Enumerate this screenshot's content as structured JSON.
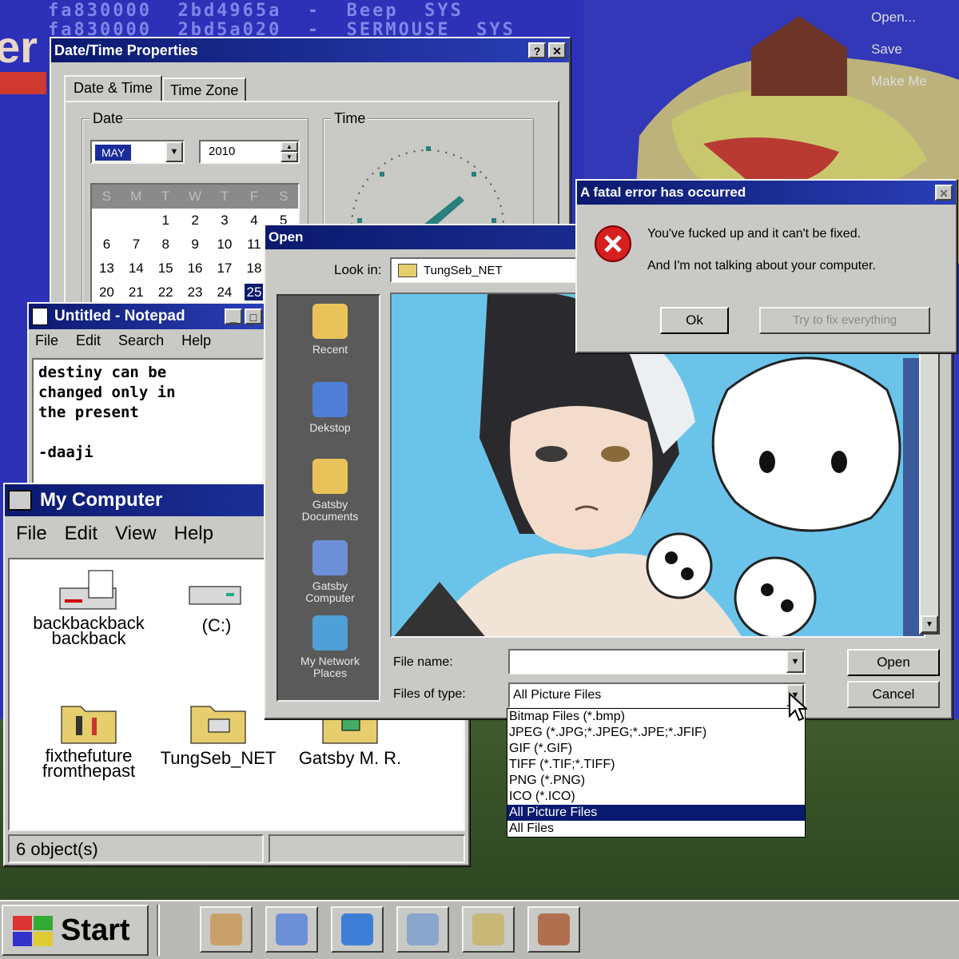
{
  "desktop": {
    "hex_rows": [
      "fa830000  2bd4965a  -  Beep  SYS",
      "fa830000  2bd5a020  -  SERMOUSE  SYS"
    ],
    "bg_fragment": "er",
    "context_menu": [
      "Open...",
      "Save",
      "Make Me"
    ]
  },
  "datetime_window": {
    "title": "Date/Time Properties",
    "help_btn": "?",
    "close_btn": "✕",
    "tabs": [
      "Date & Time",
      "Time Zone"
    ],
    "date_group": "Date",
    "time_group": "Time",
    "month": "MAY",
    "year": "2010",
    "weekdays": [
      "S",
      "M",
      "T",
      "W",
      "T",
      "F",
      "S"
    ],
    "weeks": [
      [
        "",
        "",
        "1",
        "2",
        "3",
        "4",
        "5"
      ],
      [
        "6",
        "7",
        "8",
        "9",
        "10",
        "11",
        ""
      ],
      [
        "13",
        "14",
        "15",
        "16",
        "17",
        "18",
        ""
      ],
      [
        "20",
        "21",
        "22",
        "23",
        "24",
        "25",
        ""
      ]
    ],
    "selected_day": "25"
  },
  "notepad": {
    "title": "Untitled - Notepad",
    "menu": [
      "File",
      "Edit",
      "Search",
      "Help"
    ],
    "text": "destiny can be\nchanged only in\nthe present\n\n-daaji"
  },
  "my_computer": {
    "title": "My Computer",
    "menu": [
      "File",
      "Edit",
      "View",
      "Help"
    ],
    "items": [
      {
        "label": "backbackback\nbackback",
        "icon": "floppy-drive-icon"
      },
      {
        "label": "(C:)",
        "icon": "hard-drive-icon"
      },
      {
        "label": "fixthefuture\nfromthepast",
        "icon": "control-panel-folder-icon"
      },
      {
        "label": "TungSeb_NET",
        "icon": "printers-folder-icon"
      },
      {
        "label": "Gatsby M. R.",
        "icon": "folder-icon"
      }
    ],
    "status": "6 object(s)"
  },
  "open_dialog": {
    "title": "Open",
    "look_in_label": "Look in:",
    "look_in_value": "TungSeb_NET",
    "places": [
      {
        "label": "Recent",
        "icon": "recent-folder-icon",
        "color": "#e9c35a"
      },
      {
        "label": "Dekstop",
        "icon": "desktop-icon",
        "color": "#4f7fd6"
      },
      {
        "label": "Gatsby\nDocuments",
        "icon": "documents-folder-icon",
        "color": "#e9c35a"
      },
      {
        "label": "Gatsby\nComputer",
        "icon": "computer-icon",
        "color": "#6d8fd8"
      },
      {
        "label": "My Network\nPlaces",
        "icon": "network-icon",
        "color": "#4fa0d6"
      }
    ],
    "file_name_label": "File name:",
    "file_name_value": "",
    "files_of_type_label": "Files of type:",
    "files_of_type_value": "All Picture Files",
    "open_btn": "Open",
    "cancel_btn": "Cancel",
    "type_options": [
      "Bitmap Files (*.bmp)",
      "JPEG (*.JPG;*.JPEG;*.JPE;*.JFIF)",
      "GIF (*.GIF)",
      "TIFF (*.TIF;*.TIFF)",
      "PNG (*.PNG)",
      "ICO (*.ICO)",
      "All Picture Files",
      "All Files"
    ],
    "selected_type_index": 6
  },
  "error_dialog": {
    "title": "A fatal error has occurred",
    "close_btn": "✕",
    "line1": "You've fucked up and it can't be fixed.",
    "line2": "And I'm not talking about your computer.",
    "ok_btn": "Ok",
    "fix_btn": "Try to fix everything"
  },
  "taskbar": {
    "start_label": "Start",
    "icons": [
      "paint-icon",
      "computer-icon",
      "internet-explorer-icon",
      "network-icon",
      "clock-icon",
      "tools-icon"
    ]
  },
  "colors": {
    "titlebar": "#0b1a6e",
    "desktop": "#2c31b8",
    "window": "#c9c9c5",
    "error_red": "#d61f1f"
  }
}
